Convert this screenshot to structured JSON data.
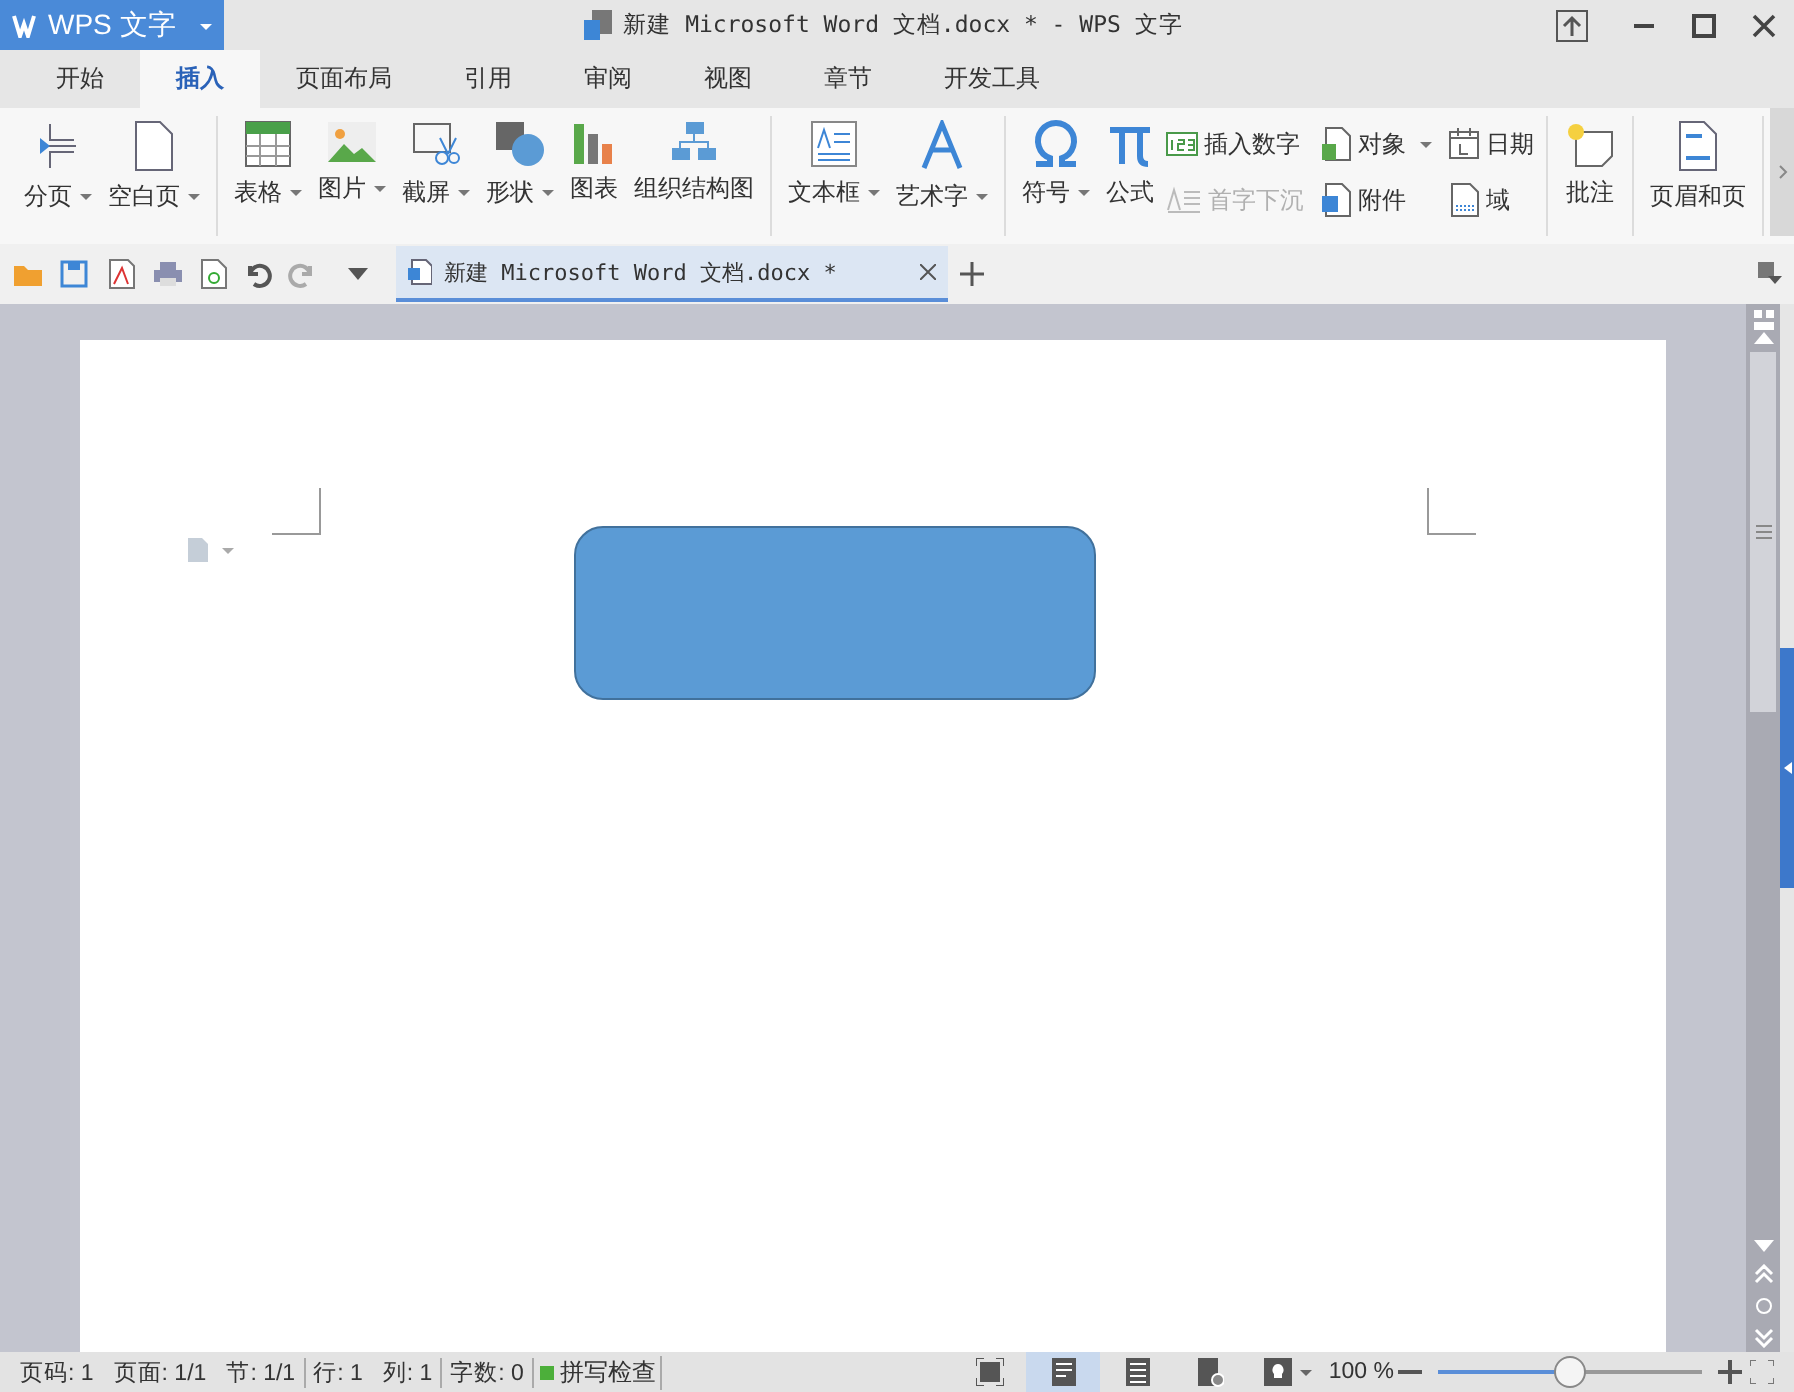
{
  "app_menu": {
    "label": "WPS 文字"
  },
  "window": {
    "title": "新建 Microsoft Word 文档.docx * - WPS 文字"
  },
  "ribbon_tabs": [
    {
      "label": "开始",
      "selected": false
    },
    {
      "label": "插入",
      "selected": true
    },
    {
      "label": "页面布局",
      "selected": false
    },
    {
      "label": "引用",
      "selected": false
    },
    {
      "label": "审阅",
      "selected": false
    },
    {
      "label": "视图",
      "selected": false
    },
    {
      "label": "章节",
      "selected": false
    },
    {
      "label": "开发工具",
      "selected": false
    }
  ],
  "ribbon": {
    "groups": [
      {
        "items": [
          {
            "kind": "large",
            "label": "分页",
            "has_menu": true
          },
          {
            "kind": "large",
            "label": "空白页",
            "has_menu": true
          }
        ]
      },
      {
        "items": [
          {
            "kind": "large",
            "label": "表格",
            "has_menu": true
          },
          {
            "kind": "large",
            "label": "图片",
            "has_menu": true
          },
          {
            "kind": "large",
            "label": "截屏",
            "has_menu": true
          },
          {
            "kind": "large",
            "label": "形状",
            "has_menu": true
          },
          {
            "kind": "large",
            "label": "图表",
            "has_menu": false
          },
          {
            "kind": "large",
            "label": "组织结构图",
            "has_menu": false
          }
        ]
      },
      {
        "items": [
          {
            "kind": "large",
            "label": "文本框",
            "has_menu": true
          },
          {
            "kind": "large",
            "label": "艺术字",
            "has_menu": true
          }
        ]
      },
      {
        "items": [
          {
            "kind": "large",
            "label": "符号",
            "has_menu": true
          },
          {
            "kind": "large",
            "label": "公式",
            "has_menu": false
          },
          {
            "kind": "small",
            "label": "插入数字",
            "has_menu": false,
            "disabled": false
          },
          {
            "kind": "small",
            "label": "首字下沉",
            "has_menu": false,
            "disabled": true
          },
          {
            "kind": "small",
            "label": "对象",
            "has_menu": true,
            "disabled": false
          },
          {
            "kind": "small",
            "label": "附件",
            "has_menu": false,
            "disabled": false
          },
          {
            "kind": "small",
            "label": "日期",
            "has_menu": false,
            "disabled": false
          },
          {
            "kind": "small",
            "label": "域",
            "has_menu": false,
            "disabled": false
          }
        ]
      },
      {
        "items": [
          {
            "kind": "large",
            "label": "批注",
            "has_menu": false
          }
        ]
      },
      {
        "items": [
          {
            "kind": "large",
            "label": "页眉和页",
            "has_menu": false
          }
        ]
      }
    ]
  },
  "document_tab": {
    "title": "新建 Microsoft Word 文档.docx *",
    "selected": true
  },
  "status_bar": {
    "groups": [
      {
        "fields": [
          "页码: 1",
          "页面: 1/1",
          "节: 1/1"
        ]
      },
      {
        "fields": [
          "行: 1",
          "列: 1"
        ]
      },
      {
        "fields": [
          "字数: 0"
        ]
      }
    ],
    "spell_check": "拼写检查",
    "view_buttons": [
      {
        "selected": false
      },
      {
        "selected": true
      },
      {
        "selected": false
      },
      {
        "selected": false
      }
    ],
    "zoom": {
      "reading": "100 %",
      "level": 0.5
    }
  }
}
